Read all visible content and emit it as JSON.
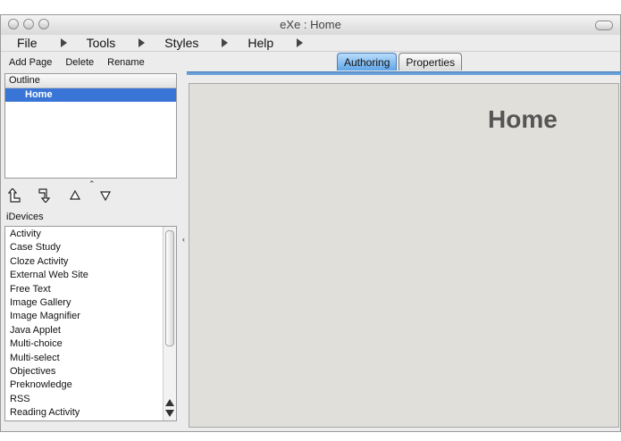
{
  "window": {
    "title": "eXe : Home"
  },
  "menu": [
    {
      "label": "File"
    },
    {
      "label": "Tools"
    },
    {
      "label": "Styles"
    },
    {
      "label": "Help"
    }
  ],
  "toolbar": {
    "add_page": "Add Page",
    "delete": "Delete",
    "rename": "Rename"
  },
  "tabs": [
    {
      "label": "Authoring",
      "active": true
    },
    {
      "label": "Properties",
      "active": false
    }
  ],
  "outline": {
    "header": "Outline",
    "nodes": [
      "Home"
    ]
  },
  "node_buttons": [
    "promote-icon",
    "demote-icon",
    "move-up-icon",
    "move-down-icon"
  ],
  "idevices": {
    "label": "iDevices",
    "items": [
      "Activity",
      "Case Study",
      "Cloze Activity",
      "External Web Site",
      "Free Text",
      "Image Gallery",
      "Image Magnifier",
      "Java Applet",
      "Multi-choice",
      "Multi-select",
      "Objectives",
      "Preknowledge",
      "RSS",
      "Reading Activity"
    ]
  },
  "content": {
    "heading": "Home"
  },
  "colors": {
    "selection": "#3875d7",
    "active_tab": "#5fa6e8",
    "content_bg": "#e0dfd9"
  }
}
